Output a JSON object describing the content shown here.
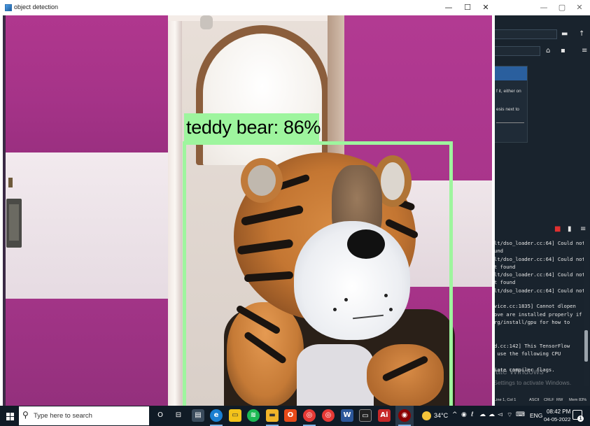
{
  "cv_window": {
    "title": "object detection",
    "minimize": "—",
    "maximize": "☐",
    "close": "✕"
  },
  "detection": {
    "label": "teddy bear: 86%",
    "box_color": "#9ef59e"
  },
  "ide": {
    "caption_minimize": "—",
    "caption_maximize": "▢",
    "caption_close": "✕",
    "help_text": [
      "f it, either on",
      "esis next to"
    ],
    "console_lines": [
      "lt/dso_loader.cc:64] Could not",
      "und",
      "lt/dso_loader.cc:64] Could not",
      "t found",
      "lt/dso_loader.cc:64] Could not",
      "t found",
      "lt/dso_loader.cc:64] Could not",
      "",
      "vice.cc:1835] Cannot dlopen",
      "ove are installed properly if",
      "rg/install/gpu for how to",
      "",
      "",
      "d.cc:142] This TensorFlow",
      " use the following CPU",
      "",
      "iate compiler flags."
    ],
    "status": {
      "position": "Line 1, Col 1",
      "encoding": "ASCII",
      "eol": "CRLF",
      "mode": "RW",
      "memory": "Mem 83%"
    },
    "activate_title": "Activate Windows",
    "activate_sub": "Go to Settings to activate Windows."
  },
  "taskbar": {
    "search_placeholder": "Type here to search",
    "weather": "34°C",
    "language": "ENG",
    "time": "08:42 PM",
    "date": "04-05-2022",
    "notification_count": "1"
  }
}
